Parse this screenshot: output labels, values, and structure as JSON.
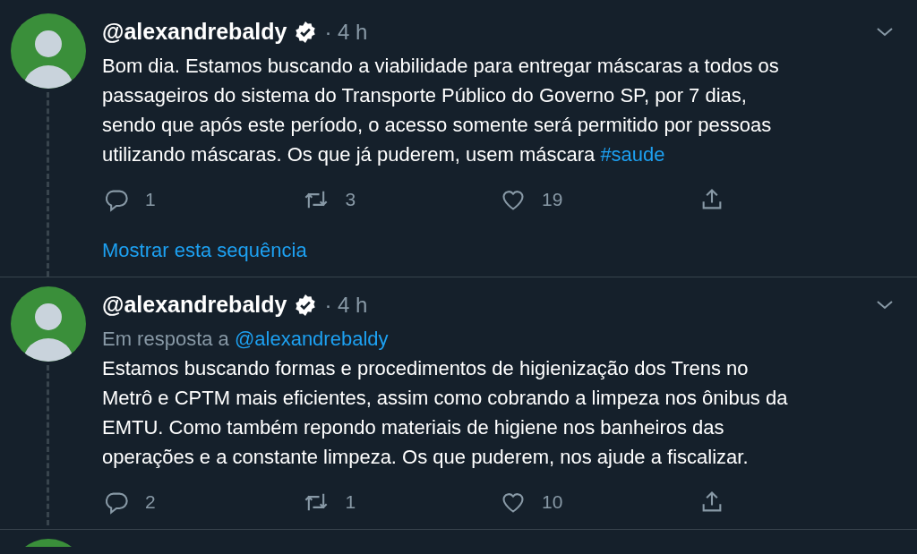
{
  "tweets": [
    {
      "handle": "@alexandrebaldy",
      "verified": true,
      "time": "· 4 h",
      "body_lines": [
        "Bom dia. Estamos buscando a viabilidade para entregar máscaras a todos os",
        "passageiros do sistema do Transporte Público do Governo SP, por 7 dias,",
        "sendo que após este período, o acesso somente será permitido por pessoas",
        "utilizando máscaras. Os que já puderem, usem máscara"
      ],
      "hashtag": "#saude",
      "replies": "1",
      "retweets": "3",
      "likes": "19",
      "show_thread": "Mostrar esta sequência"
    },
    {
      "handle": "@alexandrebaldy",
      "verified": true,
      "time": "· 4 h",
      "reply_label": "Em resposta a",
      "reply_handle": "@alexandrebaldy",
      "body_lines": [
        "Estamos buscando formas e procedimentos de higienização dos Trens no",
        "Metrô e CPTM mais eficientes, assim como cobrando a limpeza nos ônibus da",
        "EMTU. Como também repondo materiais de higiene nos banheiros das",
        "operações e a constante limpeza. Os que puderem, nos ajude a fiscalizar."
      ],
      "replies": "2",
      "retweets": "1",
      "likes": "10"
    }
  ]
}
